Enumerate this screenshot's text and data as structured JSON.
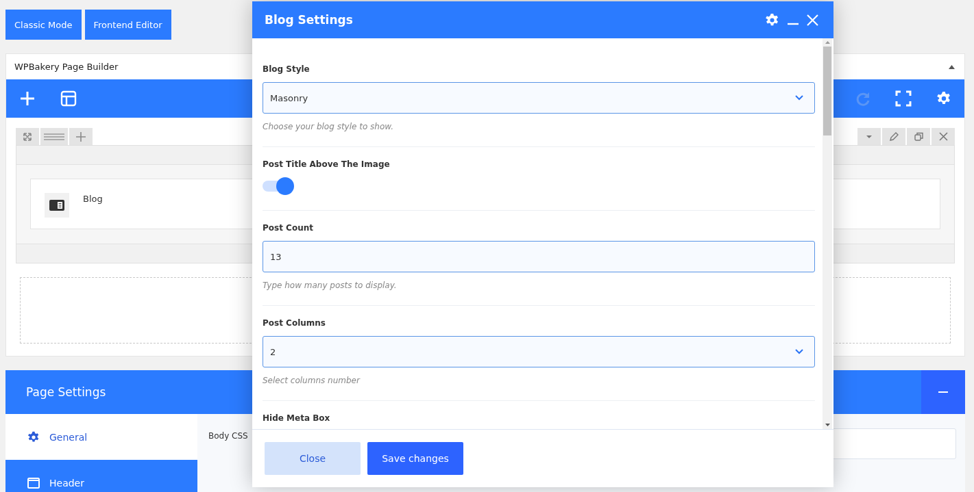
{
  "top_buttons": [
    {
      "label": "Classic Mode"
    },
    {
      "label": "Frontend Editor"
    }
  ],
  "builder": {
    "title": "WPBakery Page Builder",
    "element": "Blog"
  },
  "page_settings": {
    "title": "Page Settings",
    "field_label": "Body CSS",
    "tabs": [
      {
        "label": "General",
        "selected": false
      },
      {
        "label": "Header",
        "selected": true
      }
    ]
  },
  "modal": {
    "title": "Blog Settings",
    "fields": [
      {
        "kind": "select",
        "label": "Blog Style",
        "value": "Masonry",
        "hint": "Choose your blog style to show."
      },
      {
        "kind": "toggle",
        "label": "Post Title Above The Image",
        "on": true
      },
      {
        "kind": "text",
        "label": "Post Count",
        "value": "13",
        "hint": "Type how many posts to display."
      },
      {
        "kind": "select",
        "label": "Post Columns",
        "value": "2",
        "hint": "Select columns number"
      },
      {
        "kind": "label",
        "label": "Hide Meta Box"
      }
    ],
    "buttons": [
      {
        "kind": "secondary",
        "label": "Close"
      },
      {
        "kind": "primary",
        "label": "Save changes"
      }
    ]
  }
}
